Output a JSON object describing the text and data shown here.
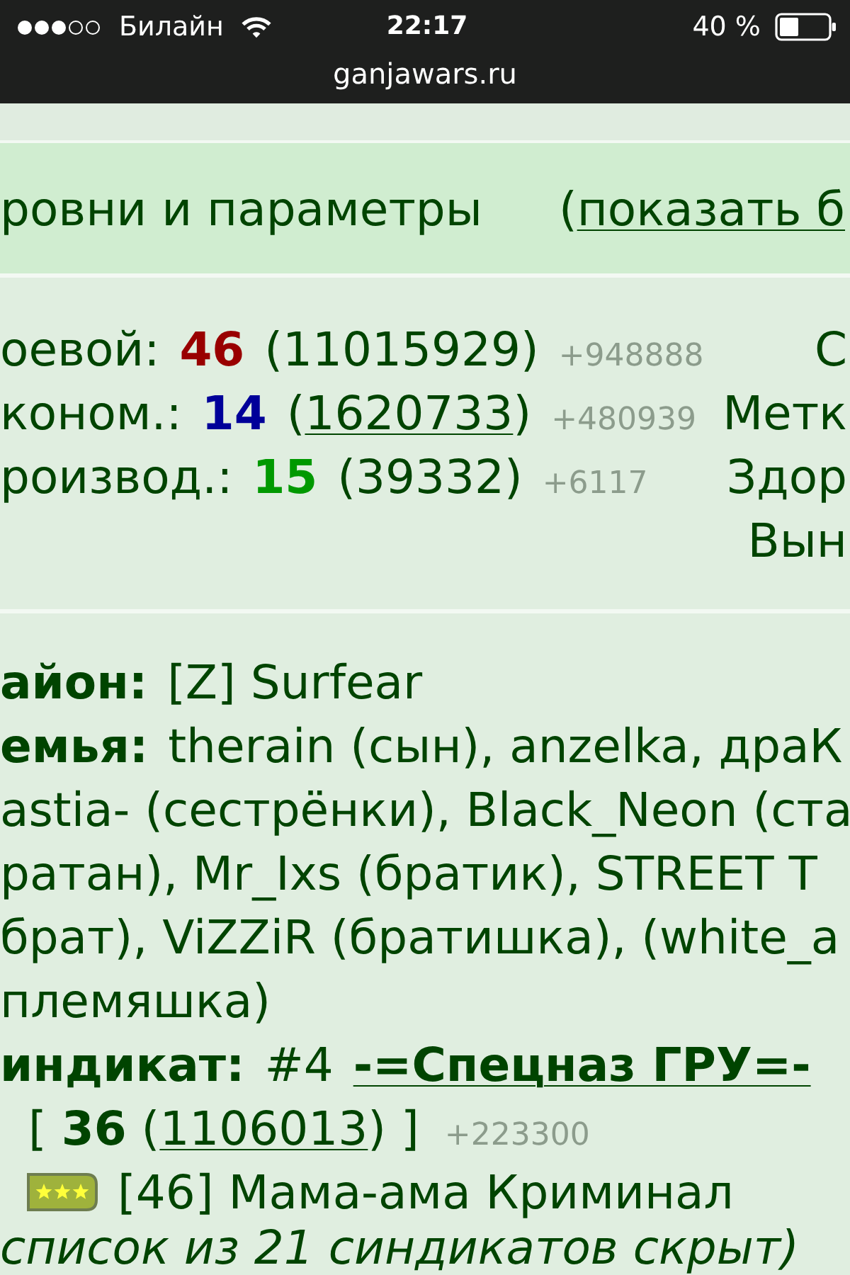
{
  "status_bar": {
    "carrier": "Билайн",
    "time": "22:17",
    "battery": "40 %",
    "url": "ganjawars.ru"
  },
  "section": {
    "title": "ровни и параметры",
    "toggle_open": "(",
    "toggle_link": "показать б"
  },
  "stats": [
    {
      "label": "оевой:",
      "value": "46",
      "color": "#990000",
      "open": "(",
      "total": "11015929",
      "close": ")",
      "linked": false,
      "increment": "+948888"
    },
    {
      "label": "коном.:",
      "value": "14",
      "color": "#000099",
      "open": "(",
      "total": "1620733",
      "close": ")",
      "linked": true,
      "increment": "+480939"
    },
    {
      "label": "роизвод.:",
      "value": "15",
      "color": "#009900",
      "open": "(",
      "total": "39332",
      "close": ")",
      "linked": false,
      "increment": "+6117"
    }
  ],
  "right_column": [
    "С",
    "Метк",
    "Здор",
    "Вын"
  ],
  "district": {
    "label": "айон:",
    "value": "[Z] Surfear"
  },
  "family": {
    "label": "емья:",
    "lines": [
      "therain (сын), anzelka, драК",
      "astia- (сестрёнки), Black_Neon (ста",
      "ратан), Mr_Ixs (братик), STREET T",
      "брат), ViZZiR (братишка), (white_a",
      "племяшка)"
    ]
  },
  "syndicate": {
    "label": "индикат:",
    "number": "#4",
    "name": "-=Спецназ ГРУ=-",
    "score_prefix": "[ **36** (",
    "total": "1106013",
    "score_suffix": ") ]",
    "increment": "+223300",
    "member": "[46] Мама-ама Криминал"
  },
  "note": "список из 21 синдикатов скрыт)"
}
